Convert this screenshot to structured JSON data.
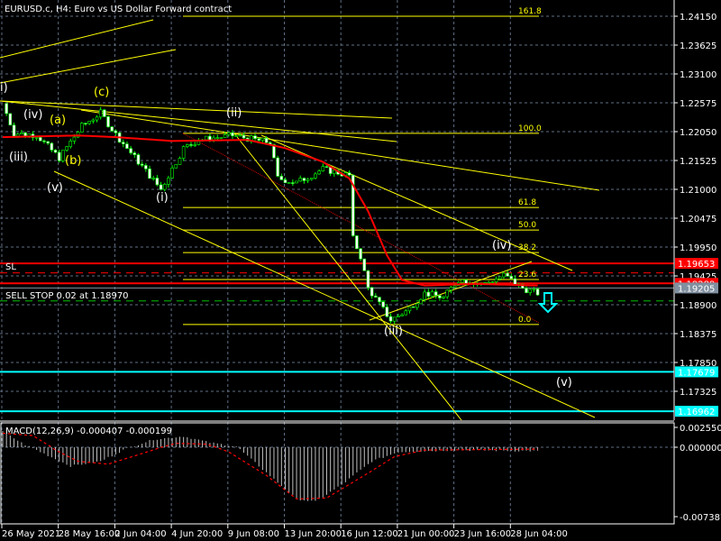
{
  "title": "EURUSD.c, H4:  Euro vs US Dollar Forward contract",
  "macd_label": "MACD(12,26,9) -0.000407 -0.000199",
  "sl_label": "SL",
  "order_label": "SELL STOP 0.02 at 1.18970",
  "colors": {
    "bg": "#000000",
    "grid": "#5f6f85",
    "bull": "#00ff00",
    "bear": "#ffffff",
    "ma": "#ff0000",
    "trend": "#ffff00",
    "cyan": "#00ffff",
    "red": "#ff0000",
    "green": "#00c000"
  },
  "chart_data": {
    "type": "candlestick",
    "symbol": "EURUSD.c",
    "timeframe": "H4",
    "ylim": [
      1.1678,
      1.2445
    ],
    "price_ticks": [
      "1.24150",
      "1.23625",
      "1.23100",
      "1.22575",
      "1.22050",
      "1.21525",
      "1.21000",
      "1.20475",
      "1.19950",
      "1.19425",
      "1.18900",
      "1.18375",
      "1.17850",
      "1.17325"
    ],
    "time_ticks": [
      "26 May 2021",
      "28 May 16:00",
      "2 Jun 04:00",
      "4 Jun 20:00",
      "9 Jun 08:00",
      "13 Jun 20:00",
      "16 Jun 12:00",
      "21 Jun 00:00",
      "23 Jun 16:00",
      "28 Jun 04:00"
    ],
    "bars_per_tick": 15,
    "price_path": [
      [
        0,
        1.2256
      ],
      [
        3,
        1.2202
      ],
      [
        9,
        1.2199
      ],
      [
        15,
        1.2157
      ],
      [
        21,
        1.2215
      ],
      [
        26,
        1.2239
      ],
      [
        30,
        1.22
      ],
      [
        39,
        1.2125
      ],
      [
        42,
        1.21
      ],
      [
        48,
        1.2175
      ],
      [
        52,
        1.219
      ],
      [
        61,
        1.2198
      ],
      [
        71,
        1.2185
      ],
      [
        73,
        1.212
      ],
      [
        78,
        1.2112
      ],
      [
        85,
        1.2137
      ],
      [
        92,
        1.2125
      ],
      [
        93,
        1.201
      ],
      [
        95,
        1.1978
      ],
      [
        97,
        1.192
      ],
      [
        103,
        1.1862
      ],
      [
        107,
        1.1878
      ],
      [
        112,
        1.1911
      ],
      [
        117,
        1.1903
      ],
      [
        121,
        1.1936
      ],
      [
        128,
        1.1928
      ],
      [
        133,
        1.1944
      ],
      [
        138,
        1.192
      ],
      [
        142,
        1.1911
      ]
    ],
    "ma_path": [
      [
        0,
        1.2195
      ],
      [
        20,
        1.2198
      ],
      [
        30,
        1.2195
      ],
      [
        45,
        1.2188
      ],
      [
        65,
        1.219
      ],
      [
        75,
        1.2175
      ],
      [
        85,
        1.215
      ],
      [
        92,
        1.212
      ],
      [
        97,
        1.206
      ],
      [
        102,
        1.198
      ],
      [
        106,
        1.1935
      ],
      [
        112,
        1.1925
      ],
      [
        125,
        1.1928
      ],
      [
        142,
        1.1925
      ]
    ],
    "levels": [
      {
        "name": "SL",
        "price": 1.19653,
        "label": "1.19653",
        "color": "#ff0000",
        "style": "solid"
      },
      {
        "name": "TP-dash",
        "price": 1.1948,
        "color": "#ff0000",
        "style": "dash"
      },
      {
        "name": "entry",
        "price": 1.19289,
        "label": "1.19289",
        "color": "#ff0000",
        "style": "solid"
      },
      {
        "name": "bid",
        "price": 1.19205,
        "label": "1.19205",
        "color": "#8090a0",
        "style": "thin"
      },
      {
        "name": "sell-stop",
        "price": 1.1897,
        "color": "#00c000",
        "style": "dash"
      },
      {
        "name": "target-1",
        "price": 1.17679,
        "label": "1.17679",
        "color": "#00ffff",
        "style": "solid"
      },
      {
        "name": "target-2",
        "price": 1.16962,
        "label": "1.16962",
        "color": "#00ffff",
        "style": "solid"
      }
    ],
    "fibonacci": [
      {
        "label": "161.8",
        "price": 1.2415
      },
      {
        "label": "100.0",
        "price": 1.2202
      },
      {
        "label": "61.8",
        "price": 1.2067
      },
      {
        "label": "50.0",
        "price": 1.2026
      },
      {
        "label": "38.2",
        "price": 1.1985
      },
      {
        "label": "23.6",
        "price": 1.1936
      },
      {
        "label": "0.0",
        "price": 1.1854
      }
    ],
    "waves": [
      {
        "label": "i)",
        "color": "#ffffff"
      },
      {
        "label": "(iv)",
        "color": "#ffffff"
      },
      {
        "label": "(a)",
        "color": "#ffff00"
      },
      {
        "label": "(c)",
        "color": "#ffff00"
      },
      {
        "label": "(iii)",
        "color": "#ffffff"
      },
      {
        "label": "(b)",
        "color": "#ffff00"
      },
      {
        "label": "(v)",
        "color": "#ffffff"
      },
      {
        "label": "(i)",
        "color": "#ffffff"
      },
      {
        "label": "(ii)",
        "color": "#ffffff"
      },
      {
        "label": "(iv)",
        "color": "#ffffff"
      },
      {
        "label": "(iii)",
        "color": "#ffffff"
      },
      {
        "label": "(v)",
        "color": "#ffffff"
      }
    ],
    "macd": {
      "params": "12,26,9",
      "main": -0.000407,
      "signal": -0.000199,
      "ticks": [
        "0.002550",
        "0.000000",
        "-0.007387"
      ],
      "hist_path": [
        [
          0,
          0.002
        ],
        [
          6,
          0.0003
        ],
        [
          10,
          -0.0005
        ],
        [
          18,
          -0.002
        ],
        [
          26,
          -0.0015
        ],
        [
          32,
          -0.0003
        ],
        [
          40,
          0.001
        ],
        [
          48,
          0.0014
        ],
        [
          55,
          0.0006
        ],
        [
          62,
          0.0001
        ],
        [
          68,
          -0.002
        ],
        [
          78,
          -0.0055
        ],
        [
          83,
          -0.0058
        ],
        [
          90,
          -0.004
        ],
        [
          98,
          -0.0015
        ],
        [
          105,
          -0.0005
        ],
        [
          120,
          -0.0003
        ],
        [
          142,
          -0.0004
        ]
      ],
      "signal_path": [
        [
          0,
          0.0018
        ],
        [
          8,
          0.0015
        ],
        [
          14,
          -0.0003
        ],
        [
          20,
          -0.0015
        ],
        [
          28,
          -0.0018
        ],
        [
          36,
          -0.0008
        ],
        [
          46,
          0.0005
        ],
        [
          54,
          0.0004
        ],
        [
          60,
          -0.0005
        ],
        [
          70,
          -0.003
        ],
        [
          78,
          -0.0055
        ],
        [
          86,
          -0.0054
        ],
        [
          96,
          -0.003
        ],
        [
          104,
          -0.001
        ],
        [
          112,
          -0.0003
        ],
        [
          142,
          -0.0002
        ]
      ]
    }
  }
}
